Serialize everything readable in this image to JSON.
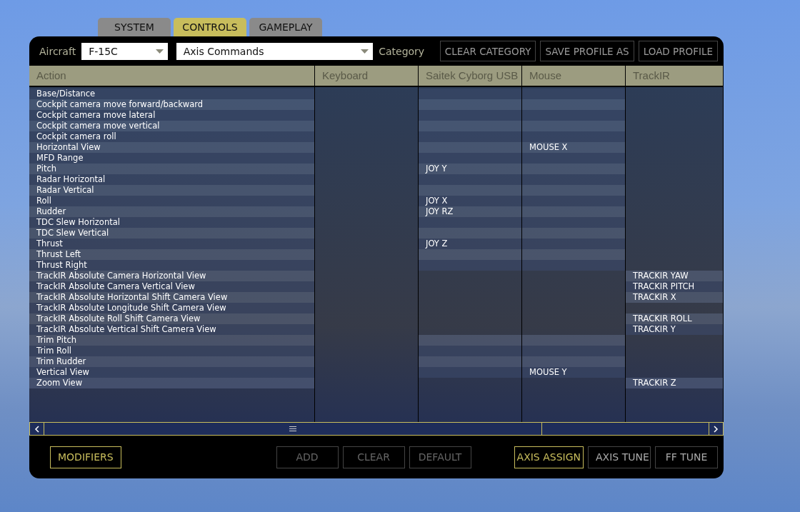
{
  "tabs": [
    {
      "label": "SYSTEM",
      "selected": false
    },
    {
      "label": "CONTROLS",
      "selected": true
    },
    {
      "label": "GAMEPLAY",
      "selected": false
    }
  ],
  "toolbar": {
    "aircraft_label": "Aircraft",
    "aircraft": "F-15C",
    "category": "Axis Commands",
    "category_label": "Category",
    "buttons": [
      "CLEAR CATEGORY",
      "SAVE PROFILE AS",
      "LOAD PROFILE"
    ]
  },
  "table": {
    "columns": [
      "Action",
      "Keyboard",
      "Saitek Cyborg USB",
      "Mouse",
      "TrackIR"
    ],
    "rows": [
      {
        "action": "Base/Distance",
        "keyboard": "",
        "joystick": "",
        "mouse": "",
        "trackir": ""
      },
      {
        "action": "Cockpit camera move forward/backward",
        "keyboard": "",
        "joystick": "",
        "mouse": "",
        "trackir": ""
      },
      {
        "action": "Cockpit camera move lateral",
        "keyboard": "",
        "joystick": "",
        "mouse": "",
        "trackir": ""
      },
      {
        "action": "Cockpit camera move vertical",
        "keyboard": "",
        "joystick": "",
        "mouse": "",
        "trackir": ""
      },
      {
        "action": "Cockpit camera roll",
        "keyboard": "",
        "joystick": "",
        "mouse": "",
        "trackir": ""
      },
      {
        "action": "Horizontal View",
        "keyboard": "",
        "joystick": "",
        "mouse": "MOUSE  X",
        "trackir": ""
      },
      {
        "action": "MFD Range",
        "keyboard": "",
        "joystick": "",
        "mouse": "",
        "trackir": ""
      },
      {
        "action": "Pitch",
        "keyboard": "",
        "joystick": "JOY  Y",
        "mouse": "",
        "trackir": ""
      },
      {
        "action": "Radar Horizontal",
        "keyboard": "",
        "joystick": "",
        "mouse": "",
        "trackir": ""
      },
      {
        "action": "Radar Vertical",
        "keyboard": "",
        "joystick": "",
        "mouse": "",
        "trackir": ""
      },
      {
        "action": "Roll",
        "keyboard": "",
        "joystick": "JOY  X",
        "mouse": "",
        "trackir": ""
      },
      {
        "action": "Rudder",
        "keyboard": "",
        "joystick": "JOY  RZ",
        "mouse": "",
        "trackir": ""
      },
      {
        "action": "TDC Slew Horizontal",
        "keyboard": "",
        "joystick": "",
        "mouse": "",
        "trackir": ""
      },
      {
        "action": "TDC Slew Vertical",
        "keyboard": "",
        "joystick": "",
        "mouse": "",
        "trackir": ""
      },
      {
        "action": "Thrust",
        "keyboard": "",
        "joystick": "JOY  Z",
        "mouse": "",
        "trackir": ""
      },
      {
        "action": "Thrust Left",
        "keyboard": "",
        "joystick": "",
        "mouse": "",
        "trackir": ""
      },
      {
        "action": "Thrust Right",
        "keyboard": "",
        "joystick": "",
        "mouse": "",
        "trackir": ""
      },
      {
        "action": "TrackIR Absolute Camera Horizontal View",
        "keyboard": "",
        "joystick": "",
        "mouse": "",
        "trackir": "TRACKIR  YAW"
      },
      {
        "action": "TrackIR Absolute Camera Vertical View",
        "keyboard": "",
        "joystick": "",
        "mouse": "",
        "trackir": "TRACKIR  PITCH"
      },
      {
        "action": "TrackIR Absolute Horizontal Shift Camera View",
        "keyboard": "",
        "joystick": "",
        "mouse": "",
        "trackir": "TRACKIR  X"
      },
      {
        "action": "TrackIR Absolute Longitude Shift Camera View",
        "keyboard": "",
        "joystick": "",
        "mouse": "",
        "trackir": ""
      },
      {
        "action": "TrackIR Absolute Roll Shift Camera View",
        "keyboard": "",
        "joystick": "",
        "mouse": "",
        "trackir": "TRACKIR  ROLL"
      },
      {
        "action": "TrackIR Absolute Vertical Shift Camera View",
        "keyboard": "",
        "joystick": "",
        "mouse": "",
        "trackir": "TRACKIR  Y"
      },
      {
        "action": "Trim Pitch",
        "keyboard": "",
        "joystick": "",
        "mouse": "",
        "trackir": ""
      },
      {
        "action": "Trim Roll",
        "keyboard": "",
        "joystick": "",
        "mouse": "",
        "trackir": ""
      },
      {
        "action": "Trim Rudder",
        "keyboard": "",
        "joystick": "",
        "mouse": "",
        "trackir": ""
      },
      {
        "action": "Vertical View",
        "keyboard": "",
        "joystick": "",
        "mouse": "MOUSE  Y",
        "trackir": ""
      },
      {
        "action": "Zoom View",
        "keyboard": "",
        "joystick": "",
        "mouse": "",
        "trackir": "TRACKIR  Z"
      }
    ]
  },
  "bottom_buttons": [
    {
      "label": "MODIFIERS",
      "kind": "left",
      "disabled": false
    },
    {
      "label": "ADD",
      "kind": "right",
      "disabled": true
    },
    {
      "label": "CLEAR",
      "kind": "right",
      "disabled": true
    },
    {
      "label": "DEFAULT",
      "kind": "right",
      "disabled": true
    },
    {
      "label": "AXIS ASSIGN",
      "kind": "mode",
      "disabled": false,
      "selected": true
    },
    {
      "label": "AXIS TUNE",
      "kind": "mode",
      "disabled": false,
      "selected": false
    },
    {
      "label": "FF TUNE",
      "kind": "mode",
      "disabled": false,
      "selected": false
    }
  ]
}
